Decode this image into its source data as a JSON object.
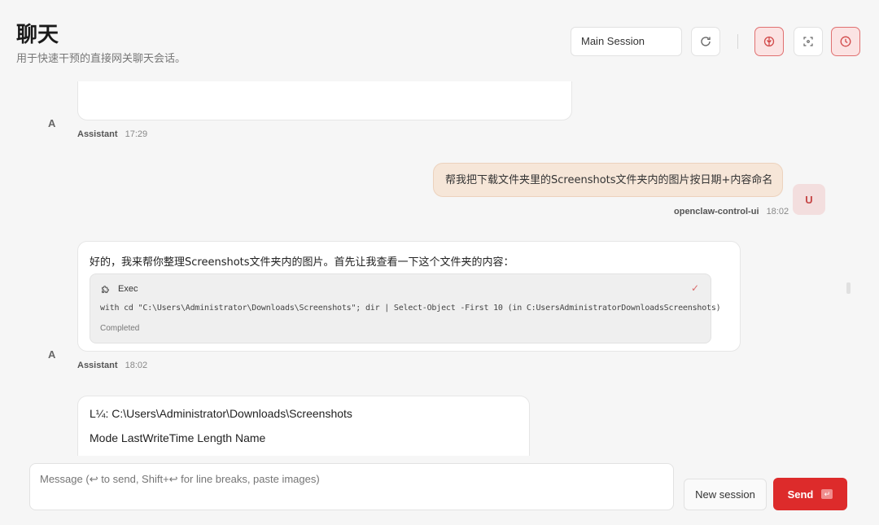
{
  "header": {
    "title": "聊天",
    "subtitle": "用于快速干预的直接网关聊天会话。",
    "session_value": "Main Session"
  },
  "icons": {
    "refresh": "refresh-icon",
    "brain": "brain-icon",
    "focus": "focus-icon",
    "clock": "clock-icon"
  },
  "messages": [
    {
      "role": "assistant",
      "avatar": "A",
      "author": "Assistant",
      "time": "17:29"
    },
    {
      "role": "user",
      "avatar": "U",
      "text": "帮我把下载文件夹里的Screenshots文件夹内的图片按日期+内容命名",
      "author": "openclaw-control-ui",
      "time": "18:02"
    },
    {
      "role": "assistant",
      "avatar": "A",
      "text": "好的，我来帮你整理Screenshots文件夹内的图片。首先让我查看一下这个文件夹的内容：",
      "tool": {
        "name": "Exec",
        "command": "with cd \"C:\\Users\\Administrator\\Downloads\\Screenshots\"; dir | Select-Object -First 10 (in C:UsersAdministratorDownloadsScreenshots)",
        "status": "Completed"
      },
      "author": "Assistant",
      "time": "18:02"
    },
    {
      "role": "assistant",
      "line1": "L¼: C:\\Users\\Administrator\\Downloads\\Screenshots",
      "line2": "Mode LastWriteTime Length Name"
    }
  ],
  "composer": {
    "placeholder": "Message (↩ to send, Shift+↩ for line breaks, paste images)",
    "new_session_label": "New session",
    "send_label": "Send",
    "send_hint": "↵"
  },
  "colors": {
    "accent": "#dd2b2b",
    "user_bubble": "#f6e6d8",
    "background": "#f6f6f6"
  }
}
